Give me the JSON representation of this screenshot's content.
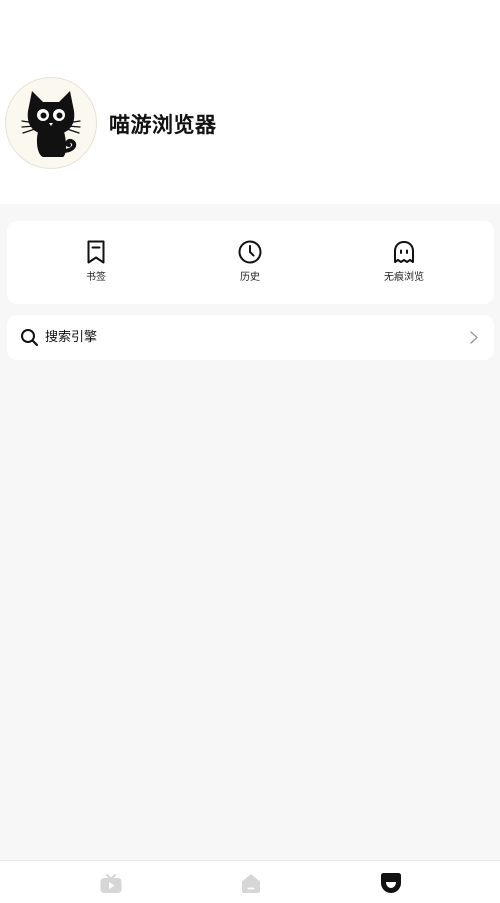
{
  "app": {
    "title": "喵游浏览器"
  },
  "quick_actions": [
    {
      "label": "书签",
      "icon": "bookmark-icon"
    },
    {
      "label": "历史",
      "icon": "clock-icon"
    },
    {
      "label": "无痕浏览",
      "icon": "ghost-icon"
    }
  ],
  "search_engine": {
    "label": "搜索引擎",
    "icon": "search-icon",
    "trailing_icon": "chevron-right-icon"
  },
  "bottom_nav": [
    {
      "icon": "video-icon",
      "active": false
    },
    {
      "icon": "home-icon",
      "active": false
    },
    {
      "icon": "profile-icon",
      "active": true
    }
  ],
  "colors": {
    "background": "#f7f7f7",
    "card": "#ffffff",
    "text": "#111111",
    "inactive_icon": "#d6d6d6",
    "active_icon": "#111111"
  }
}
